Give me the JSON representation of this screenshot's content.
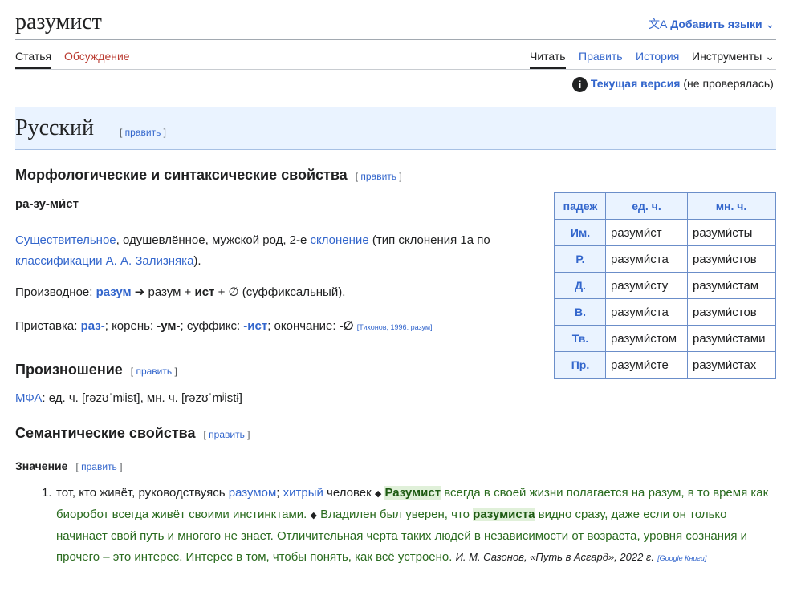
{
  "page": {
    "title": "разумист",
    "add_languages": "Добавить языки",
    "tabs_left": [
      "Статья",
      "Обсуждение"
    ],
    "tabs_right": [
      "Читать",
      "Править",
      "История",
      "Инструменты"
    ],
    "current_version": "Текущая версия",
    "not_checked": "(не проверялась)"
  },
  "section_lang": {
    "title": "Русский",
    "edit_open": "[",
    "edit": "править",
    "edit_close": "]"
  },
  "morph": {
    "title": "Морфологические и синтаксические свойства",
    "syllables": "ра-зу-ми́ст",
    "pos": "Существительное",
    "pos_rest": ", одушевлённое, мужской род, 2-е ",
    "decl_link": "склонение",
    "decl_rest": " (тип склонения 1a по ",
    "classif_link": "классификации А. А. Зализняка",
    "classif_end": ").",
    "deriv_label": "Производное: ",
    "deriv_word": "разум",
    "deriv_arrow": " ➔ разум + ",
    "deriv_suffix": "ист",
    "deriv_rest": " + ∅ (суффиксальный).",
    "prefix_label": "Приставка: ",
    "prefix": "раз-",
    "root_label": "; корень: ",
    "root": "-ум-",
    "suffix_label": "; суффикс: ",
    "suffix": "-ист",
    "ending_label": "; окончание: ",
    "ending": "-∅",
    "source": "[Тихонов, 1996: разум]"
  },
  "declension": {
    "headers": [
      "падеж",
      "ед. ч.",
      "мн. ч."
    ],
    "rows": [
      [
        "Им.",
        "разуми́ст",
        "разуми́сты"
      ],
      [
        "Р.",
        "разуми́ста",
        "разуми́стов"
      ],
      [
        "Д.",
        "разуми́сту",
        "разуми́стам"
      ],
      [
        "В.",
        "разуми́ста",
        "разуми́стов"
      ],
      [
        "Тв.",
        "разуми́стом",
        "разуми́стами"
      ],
      [
        "Пр.",
        "разуми́сте",
        "разуми́стах"
      ]
    ]
  },
  "pron": {
    "title": "Произношение",
    "ipa_link": "МФА",
    "ipa_text": ": ед. ч. [rəzʊˈmʲist], мн. ч. [rəzʊˈmʲistɨ]"
  },
  "sem": {
    "title": "Семантические свойства",
    "meaning_title": "Значение",
    "def_1": "тот, кто живёт, руководствуясь ",
    "def_link1": "разумом",
    "def_sep": "; ",
    "def_link2": "хитрый",
    "def_2": " человек",
    "ex_word1": "Разумист",
    "ex_1": " всегда в своей жизни полагается на разум, в то время как биоробот всегда живёт своими инстинктами.",
    "ex_2a": " Владилен был уверен, что ",
    "ex_word2": "разумиста",
    "ex_2b": " видно сразу, даже если он только начинает свой путь и многого не знает. Отличительная черта таких людей в независимости от возраста, уровня сознания и прочего – это интерес. Интерес в том, чтобы понять, как всё устроено.",
    "author": " И. М. Сазонов, «Путь в Асгард», 2022 г.",
    "book_src": "[Google Книги]",
    "diamond": "◆"
  },
  "colors": {
    "link": "#3366cc",
    "heading_bg": "#eaf3ff",
    "example": "#2a6b1f"
  }
}
